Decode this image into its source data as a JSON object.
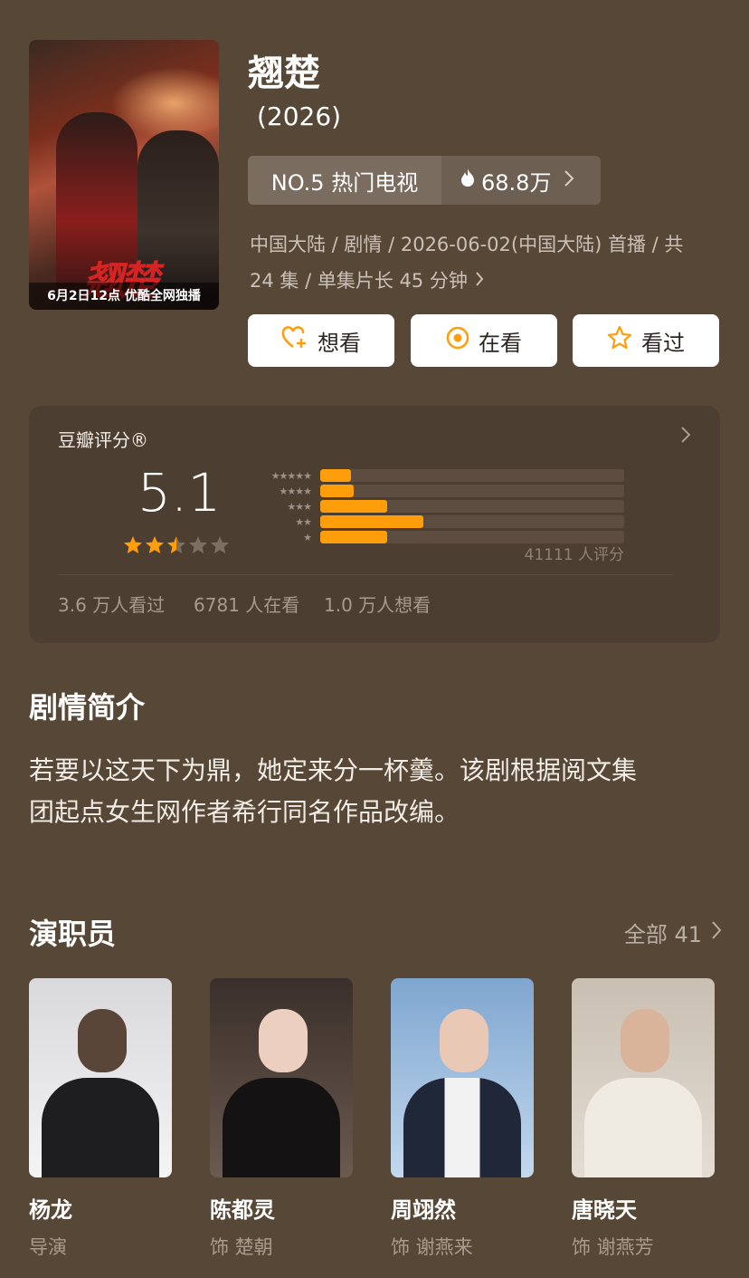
{
  "show": {
    "title": "翘楚",
    "year": "(2026)",
    "poster_caption": "6月2日12点 优酷全网独播",
    "poster_title_art": "翘楚",
    "rank_label": "NO.5 热门电视",
    "heat": "68.8万",
    "meta_line1": "中国大陆 / 剧情 / 2026-06-02(中国大陆) 首播 / 共",
    "meta_line2": "24 集 / 单集片长 45 分钟"
  },
  "actions": {
    "want": "想看",
    "watching": "在看",
    "watched": "看过"
  },
  "rating": {
    "label": "豆瓣评分®",
    "score": "5.1",
    "star_value": 2.5,
    "count": "41111 人评分",
    "distribution": [
      {
        "stars": "★★★★★",
        "fraction": 0.1
      },
      {
        "stars": "★★★★",
        "fraction": 0.11
      },
      {
        "stars": "★★★",
        "fraction": 0.22
      },
      {
        "stars": "★★",
        "fraction": 0.34
      },
      {
        "stars": "★",
        "fraction": 0.22
      }
    ],
    "stats": {
      "watched": "3.6 万人看过",
      "watching": "6781 人在看",
      "want": "1.0 万人想看"
    }
  },
  "synopsis": {
    "heading": "剧情简介",
    "text_line1": "若要以这天下为鼎，她定来分一杯羹。该剧根据阅文集",
    "text_line2": "团起点女生网作者希行同名作品改编。"
  },
  "cast": {
    "heading": "演职员",
    "more": "全部 41",
    "members": [
      {
        "name": "杨龙",
        "role": "导演"
      },
      {
        "name": "陈都灵",
        "role": "饰 楚朝"
      },
      {
        "name": "周翊然",
        "role": "饰 谢燕来"
      },
      {
        "name": "唐晓天",
        "role": "饰 谢燕芳"
      }
    ]
  },
  "colors": {
    "background": "#574736",
    "card": "#4c3e31",
    "accent": "#ff9d0a"
  }
}
